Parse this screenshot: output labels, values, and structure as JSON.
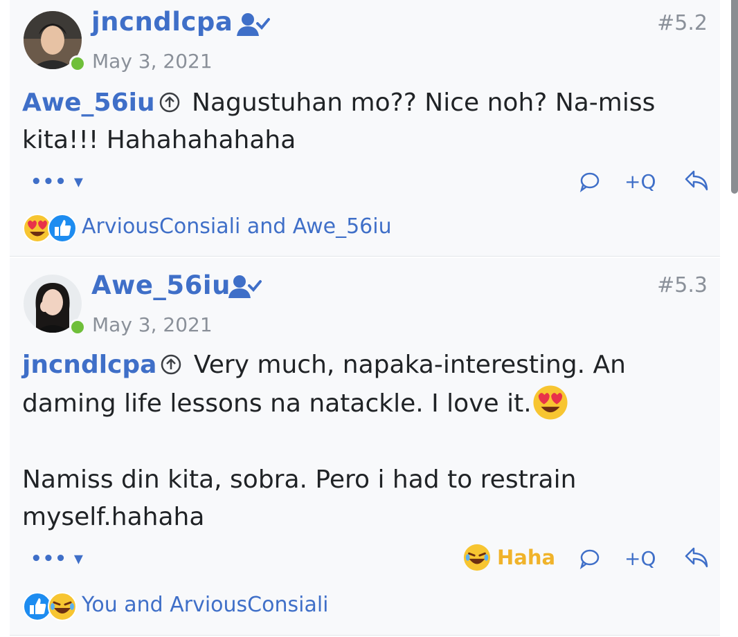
{
  "posts": [
    {
      "username": "jncndlcpa",
      "user_icon": "user-check-icon",
      "date": "May 3, 2021",
      "post_number": "#5.2",
      "mention": "Awe_56iu",
      "body": " Nagustuhan mo?? Nice noh? Na-miss kita!!! Hahahahahaha",
      "more_label": "••• ▾",
      "quote_label": "+Q",
      "reactions": {
        "icons": [
          "heart-eyes-emoji",
          "like-icon"
        ],
        "text": "ArviousConsiali and Awe_56iu"
      }
    },
    {
      "username": "Awe_56iu",
      "user_icon": "user-check-icon",
      "date": "May 3, 2021",
      "post_number": "#5.3",
      "mention": "jncndlcpa",
      "body_line1": " Very much, napaka-interesting. An daming life lessons na natackle. I love it.",
      "body_para2": "Namiss din kita, sobra. Pero i had to restrain myself.hahaha",
      "more_label": "••• ▾",
      "my_reaction": "Haha",
      "quote_label": "+Q",
      "reactions": {
        "icons": [
          "like-icon",
          "laughing-emoji"
        ],
        "text": "You and ArviousConsiali"
      }
    }
  ],
  "colors": {
    "accent": "#3f6fc8",
    "muted": "#8a9099",
    "online": "#6fbf3a",
    "haha": "#f0b32a"
  }
}
